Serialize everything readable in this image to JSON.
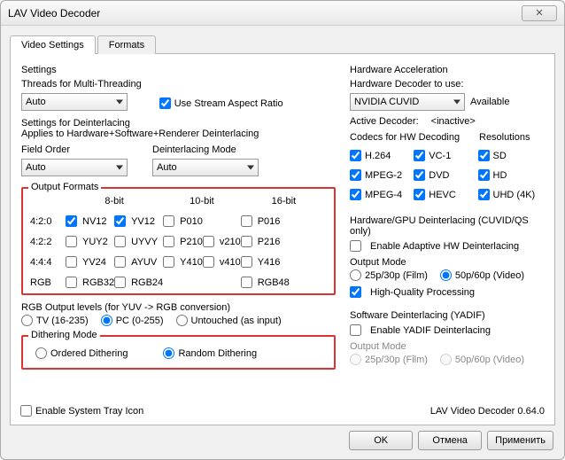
{
  "window": {
    "title": "LAV Video Decoder"
  },
  "tabs": {
    "video_settings": "Video Settings",
    "formats": "Formats"
  },
  "settings": {
    "heading": "Settings",
    "threads_label": "Threads for Multi-Threading",
    "threads_value": "Auto",
    "use_stream_ar": {
      "label": "Use Stream Aspect Ratio",
      "checked": true
    },
    "deint_heading": "Settings for Deinterlacing",
    "deint_sub": "Applies to Hardware+Software+Renderer Deinterlacing",
    "field_order_label": "Field Order",
    "field_order_value": "Auto",
    "deint_mode_label": "Deinterlacing Mode",
    "deint_mode_value": "Auto"
  },
  "output_formats": {
    "heading": "Output Formats",
    "column_groups": [
      "8-bit",
      "10-bit",
      "16-bit"
    ],
    "rows": [
      {
        "label": "4:2:0",
        "cells": [
          {
            "name": "NV12",
            "checked": true
          },
          {
            "name": "YV12",
            "checked": true
          },
          {
            "name": "P010",
            "checked": false
          },
          {
            "name": "",
            "checked": null
          },
          {
            "name": "P016",
            "checked": false
          },
          {
            "name": "",
            "checked": null
          }
        ]
      },
      {
        "label": "4:2:2",
        "cells": [
          {
            "name": "YUY2",
            "checked": false
          },
          {
            "name": "UYVY",
            "checked": false
          },
          {
            "name": "P210",
            "checked": false
          },
          {
            "name": "v210",
            "checked": false
          },
          {
            "name": "P216",
            "checked": false
          },
          {
            "name": "",
            "checked": null
          }
        ]
      },
      {
        "label": "4:4:4",
        "cells": [
          {
            "name": "YV24",
            "checked": false
          },
          {
            "name": "AYUV",
            "checked": false
          },
          {
            "name": "Y410",
            "checked": false
          },
          {
            "name": "v410",
            "checked": false
          },
          {
            "name": "Y416",
            "checked": false
          },
          {
            "name": "",
            "checked": null
          }
        ]
      },
      {
        "label": "RGB",
        "cells": [
          {
            "name": "RGB32",
            "checked": false
          },
          {
            "name": "RGB24",
            "checked": false
          },
          {
            "name": "",
            "checked": null
          },
          {
            "name": "",
            "checked": null
          },
          {
            "name": "RGB48",
            "checked": false
          },
          {
            "name": "",
            "checked": null
          }
        ]
      }
    ]
  },
  "rgb_levels": {
    "heading": "RGB Output levels (for YUV -> RGB conversion)",
    "options": [
      {
        "label": "TV (16-235)",
        "checked": false
      },
      {
        "label": "PC (0-255)",
        "checked": true
      },
      {
        "label": "Untouched (as input)",
        "checked": false
      }
    ]
  },
  "dithering": {
    "heading": "Dithering Mode",
    "options": [
      {
        "label": "Ordered Dithering",
        "checked": false
      },
      {
        "label": "Random Dithering",
        "checked": true
      }
    ]
  },
  "tray": {
    "label": "Enable System Tray Icon",
    "checked": false
  },
  "version": "LAV Video Decoder 0.64.0",
  "hw": {
    "heading": "Hardware Acceleration",
    "decoder_label": "Hardware Decoder to use:",
    "decoder_value": "NVIDIA CUVID",
    "available": "Available",
    "active_label": "Active Decoder:",
    "active_value": "<inactive>",
    "codecs_heading": "Codecs for HW Decoding",
    "res_heading": "Resolutions",
    "codecs": [
      {
        "name": "H.264",
        "checked": true
      },
      {
        "name": "VC-1",
        "checked": true
      },
      {
        "name": "MPEG-2",
        "checked": true
      },
      {
        "name": "DVD",
        "checked": true
      },
      {
        "name": "MPEG-4",
        "checked": true
      },
      {
        "name": "HEVC",
        "checked": true
      }
    ],
    "resolutions": [
      {
        "name": "SD",
        "checked": true
      },
      {
        "name": "HD",
        "checked": true
      },
      {
        "name": "UHD (4K)",
        "checked": true
      }
    ]
  },
  "gpu_deint": {
    "heading": "Hardware/GPU Deinterlacing (CUVID/QS only)",
    "adaptive": {
      "label": "Enable Adaptive HW Deinterlacing",
      "checked": false
    },
    "output_mode_label": "Output Mode",
    "options": [
      {
        "label": "25p/30p (Film)",
        "checked": false
      },
      {
        "label": "50p/60p (Video)",
        "checked": true
      }
    ],
    "hq": {
      "label": "High-Quality Processing",
      "checked": true
    }
  },
  "sw_deint": {
    "heading": "Software Deinterlacing (YADIF)",
    "enable": {
      "label": "Enable YADIF Deinterlacing",
      "checked": false
    },
    "output_mode_label": "Output Mode",
    "options": [
      {
        "label": "25p/30p (Film)",
        "checked": false
      },
      {
        "label": "50p/60p (Video)",
        "checked": false
      }
    ]
  },
  "buttons": {
    "ok": "OK",
    "cancel": "Отмена",
    "apply": "Применить"
  }
}
